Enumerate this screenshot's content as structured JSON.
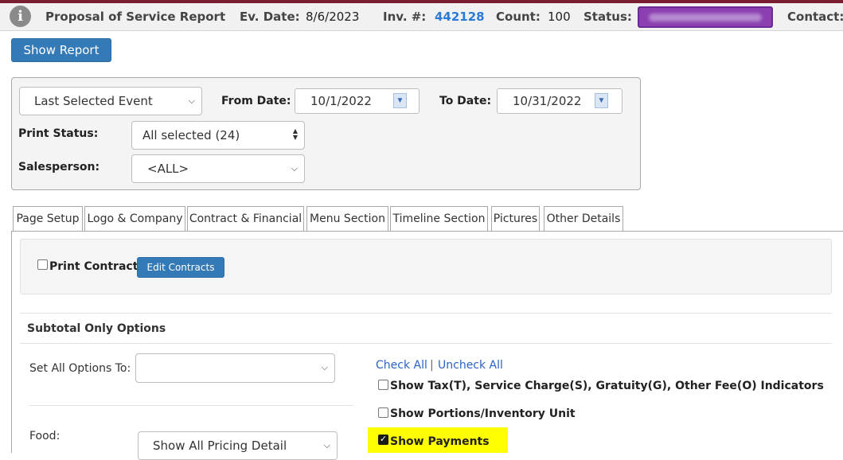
{
  "header": {
    "info_icon": "i",
    "title": "Proposal of Service Report",
    "ev_date_label": "Ev. Date:",
    "ev_date_value": "8/6/2023",
    "inv_label": "Inv. #:",
    "inv_value": "442128",
    "count_label": "Count:",
    "count_value": "100",
    "status_label": "Status:",
    "contact_label": "Contact:"
  },
  "toolbar": {
    "show_report_label": "Show Report"
  },
  "filters": {
    "event_select": "Last Selected Event",
    "from_date_label": "From Date:",
    "from_date_value": "10/1/2022",
    "to_date_label": "To Date:",
    "to_date_value": "10/31/2022",
    "print_status_label": "Print Status:",
    "print_status_value": "All selected (24)",
    "salesperson_label": "Salesperson:",
    "salesperson_value": "<ALL>"
  },
  "tabs": [
    {
      "label": "Page Setup"
    },
    {
      "label": "Logo & Company"
    },
    {
      "label": "Contract & Financial"
    },
    {
      "label": "Menu Section"
    },
    {
      "label": "Timeline Section"
    },
    {
      "label": "Pictures"
    },
    {
      "label": "Other Details"
    }
  ],
  "contract": {
    "print_contract_label": "Print Contract",
    "edit_contracts_label": "Edit Contracts"
  },
  "subtotal": {
    "title": "Subtotal Only Options",
    "set_all_label": "Set All Options To:",
    "set_all_value": "",
    "check_all": "Check All",
    "separator": "|",
    "uncheck_all": "Uncheck All",
    "opt_tax_label": "Show Tax(T), Service Charge(S), Gratuity(G), Other Fee(O) Indicators",
    "opt_portions_label": "Show Portions/Inventory Unit",
    "opt_payments_label": "Show Payments",
    "food_label": "Food:",
    "food_value": "Show All Pricing Detail"
  },
  "colors": {
    "brand_bar": "#7a1f33",
    "primary_button": "#337ab7",
    "status_badge": "#8b3fb0",
    "invoice_link": "#2b7bd6",
    "highlight": "#ffff00"
  },
  "icons": [
    "info-icon",
    "chevron-down-icon",
    "calendar-dropdown-icon",
    "up-down-icon"
  ]
}
